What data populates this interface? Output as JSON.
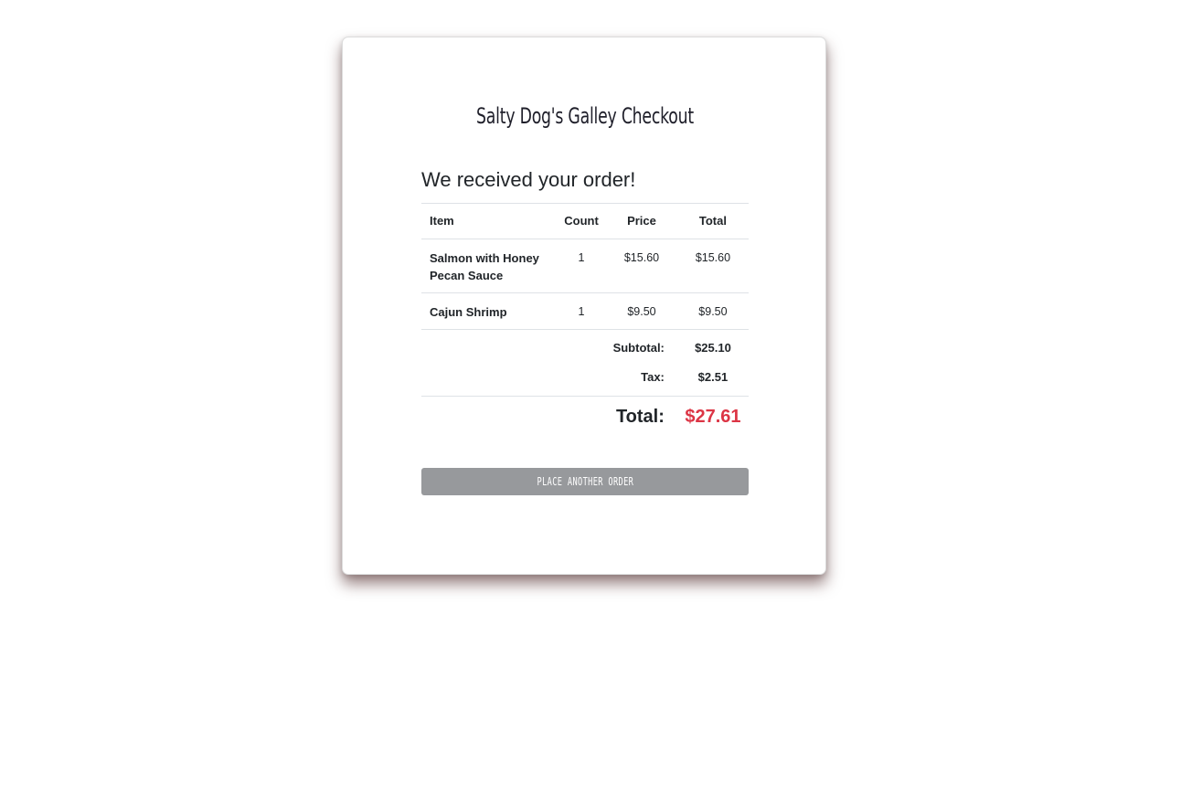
{
  "app_title": "Salty Dog's Galley Checkout",
  "confirmation": {
    "heading": "We received your order!"
  },
  "table": {
    "headers": {
      "item": "Item",
      "count": "Count",
      "price": "Price",
      "total": "Total"
    },
    "rows": [
      {
        "item": "Salmon with Honey Pecan Sauce",
        "count": "1",
        "price": "$15.60",
        "total": "$15.60"
      },
      {
        "item": "Cajun Shrimp",
        "count": "1",
        "price": "$9.50",
        "total": "$9.50"
      }
    ],
    "summary": {
      "subtotal_label": "Subtotal:",
      "subtotal_value": "$25.10",
      "tax_label": "Tax:",
      "tax_value": "$2.51",
      "total_label": "Total:",
      "total_value": "$27.61"
    }
  },
  "actions": {
    "place_another_order_label": "Place Another Order"
  },
  "colors": {
    "total_accent": "#dc3545",
    "button_bg": "#97999c"
  }
}
